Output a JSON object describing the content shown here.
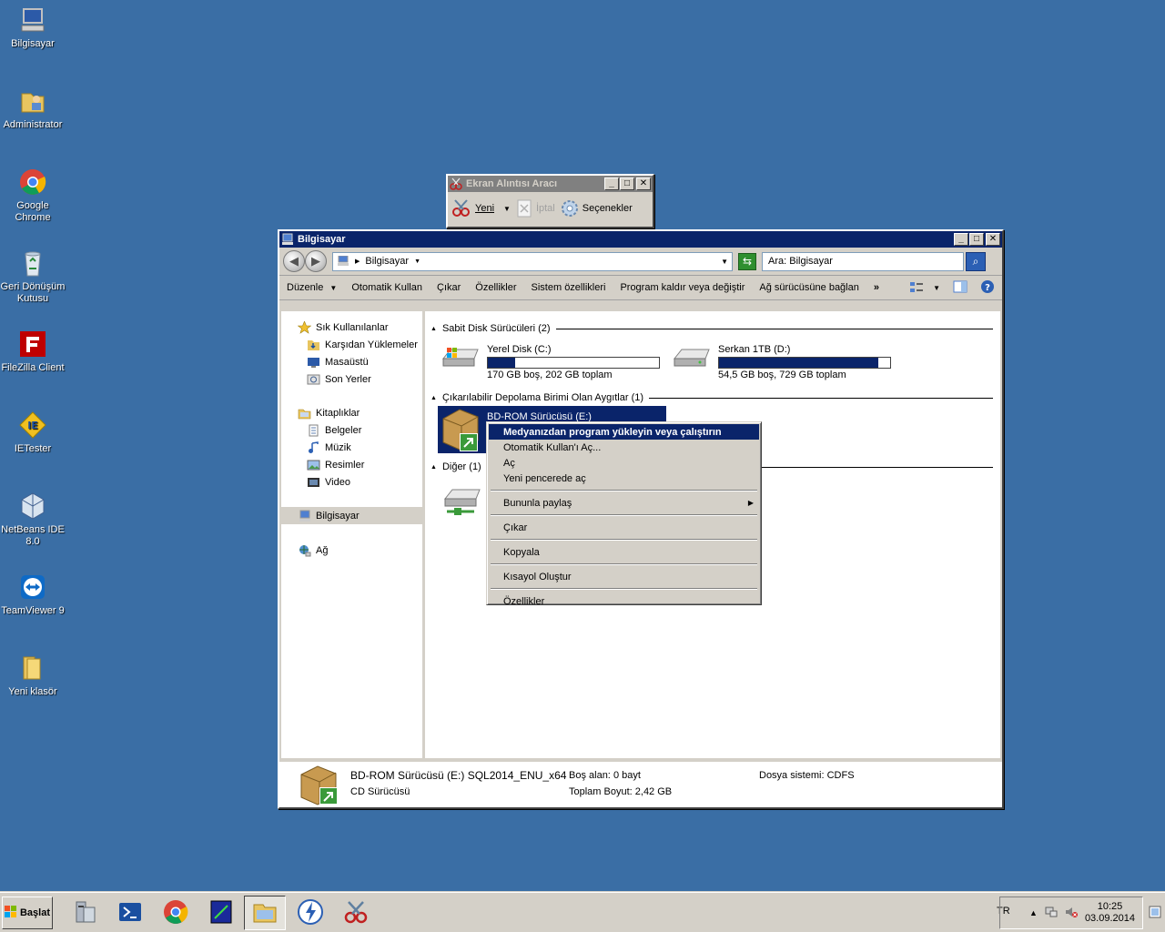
{
  "desktop": {
    "icons": [
      {
        "label": "Bilgisayar",
        "icon": "computer-icon"
      },
      {
        "label": "Administrator",
        "icon": "user-folder-icon"
      },
      {
        "label": "Google Chrome",
        "icon": "chrome-icon"
      },
      {
        "label": "Geri Dönüşüm Kutusu",
        "icon": "recycle-bin-icon"
      },
      {
        "label": "FileZilla Client",
        "icon": "filezilla-icon"
      },
      {
        "label": "IETester",
        "icon": "ietester-icon"
      },
      {
        "label": "NetBeans IDE 8.0",
        "icon": "netbeans-icon"
      },
      {
        "label": "TeamViewer 9",
        "icon": "teamviewer-icon"
      },
      {
        "label": "Yeni klasör",
        "icon": "folder-icon"
      }
    ]
  },
  "snip": {
    "title": "Ekran Alıntısı Aracı",
    "new_label": "Yeni",
    "cancel_label": "İptal",
    "options_label": "Seçenekler"
  },
  "explorer": {
    "title": "Bilgisayar",
    "address": "Bilgisayar",
    "search_placeholder": "Ara: Bilgisayar",
    "commands": [
      "Düzenle",
      "Otomatik Kullan",
      "Çıkar",
      "Özellikler",
      "Sistem özellikleri",
      "Program kaldır veya değiştir",
      "Ağ sürücüsüne bağlan"
    ],
    "more": "»",
    "nav": {
      "favorites": "Sık Kullanılanlar",
      "downloads": "Karşıdan Yüklemeler",
      "desktop": "Masaüstü",
      "recent": "Son Yerler",
      "libraries": "Kitaplıklar",
      "documents": "Belgeler",
      "music": "Müzik",
      "pictures": "Resimler",
      "video": "Video",
      "computer": "Bilgisayar",
      "network": "Ağ"
    },
    "groups": {
      "hdd": "Sabit Disk Sürücüleri (2)",
      "removable": "Çıkarılabilir Depolama Birimi Olan Aygıtlar (1)",
      "other": "Diğer (1)"
    },
    "drives": {
      "c": {
        "name": "Yerel Disk (C:)",
        "info": "170 GB boş, 202 GB toplam",
        "used_fraction": 0.16
      },
      "d": {
        "name": "Serkan 1TB (D:)",
        "info": "54,5 GB boş, 729 GB toplam",
        "used_fraction": 0.93
      },
      "e": {
        "name": "BD-ROM Sürücüsü (E:)"
      }
    },
    "status": {
      "name": "BD-ROM Sürücüsü (E:) SQL2014_ENU_x64",
      "type": "CD Sürücüsü",
      "free_label": "Boş alan:",
      "free_value": "0 bayt",
      "total_label": "Toplam Boyut:",
      "total_value": "2,42 GB",
      "fs_label": "Dosya sistemi:",
      "fs_value": "CDFS"
    }
  },
  "context_menu": {
    "items": [
      "Medyanızdan program yükleyin veya çalıştırın",
      "Otomatik Kullan'ı Aç...",
      "Aç",
      "Yeni pencerede aç",
      "Bununla paylaş",
      "Çıkar",
      "Kopyala",
      "Kısayol Oluştur",
      "Özellikler"
    ]
  },
  "taskbar": {
    "start_label": "Başlat",
    "lang": "TR",
    "time": "10:25",
    "date": "03.09.2014"
  },
  "colors": {
    "desktop": "#3a6ea5",
    "title_active": "#0a246a",
    "highlight": "#0a246a",
    "face": "#d4d0c8"
  }
}
